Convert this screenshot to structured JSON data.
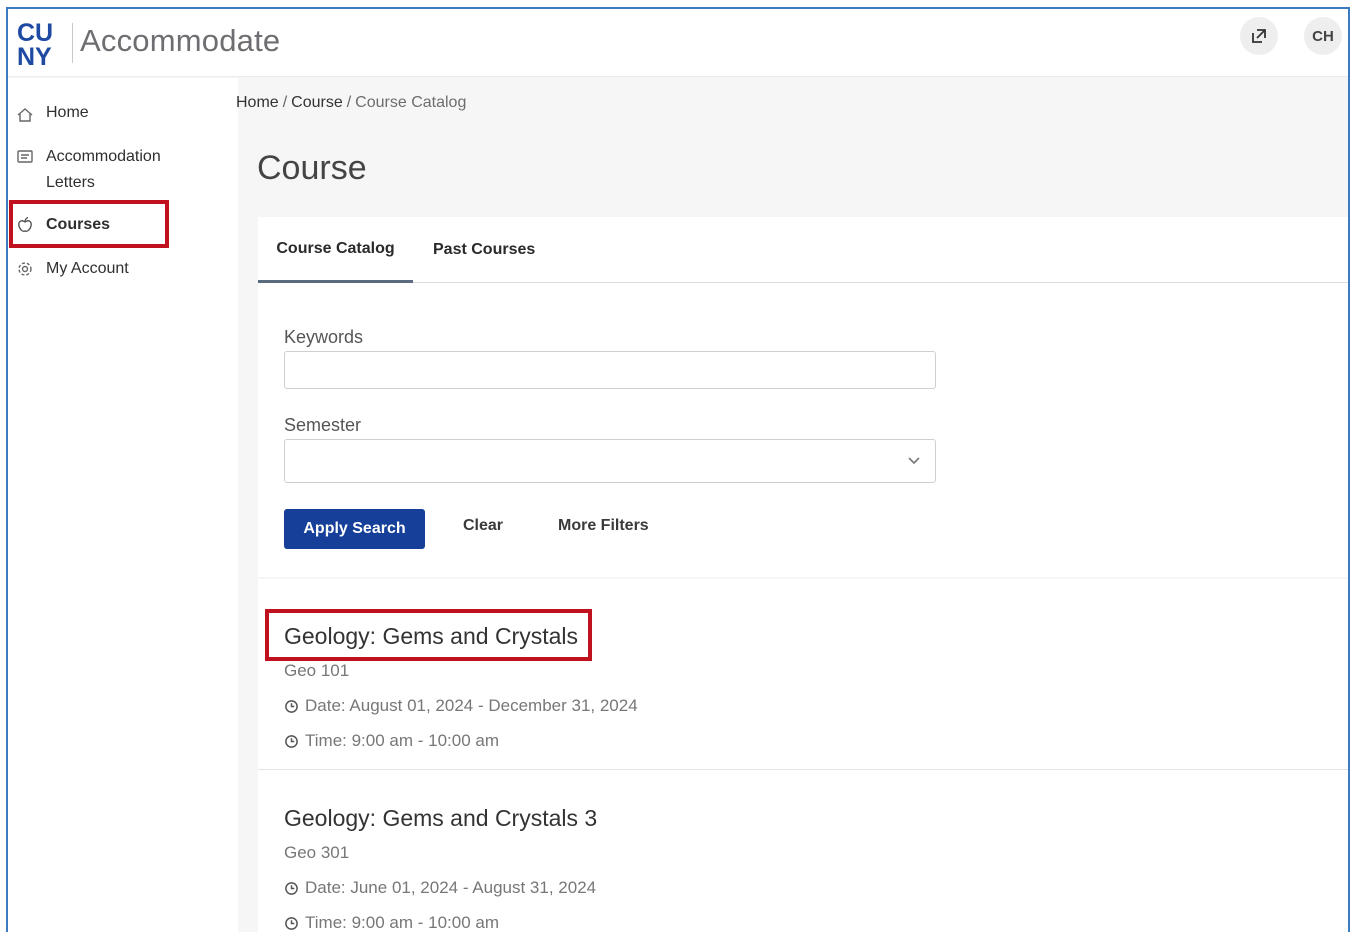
{
  "header": {
    "logo_text_top": "CU",
    "logo_text_bottom": "NY",
    "app_title": "Accommodate",
    "avatar_initials": "CH",
    "external_icon": "external-link-icon"
  },
  "sidebar": {
    "items": [
      {
        "label": "Home",
        "icon": "home-icon"
      },
      {
        "label": "Accommodation",
        "label2": "Letters",
        "icon": "letter-icon"
      },
      {
        "label": "Courses",
        "icon": "apple-icon"
      },
      {
        "label": "My Account",
        "icon": "gear-icon"
      }
    ]
  },
  "breadcrumb": {
    "home": "Home",
    "course": "Course",
    "current": "Course Catalog"
  },
  "page_title": "Course",
  "tabs": [
    {
      "label": "Course Catalog"
    },
    {
      "label": "Past Courses"
    }
  ],
  "search": {
    "keywords_label": "Keywords",
    "keywords_value": "",
    "semester_label": "Semester",
    "semester_value": "",
    "apply_label": "Apply Search",
    "clear_label": "Clear",
    "more_filters_label": "More Filters"
  },
  "colors": {
    "primary": "#153f99",
    "highlight": "#c0111f",
    "frame": "#3b7bbf",
    "logo": "#1e4aa3"
  },
  "courses": [
    {
      "title": "Geology: Gems and Crystals",
      "code": "Geo 101",
      "date": "Date: August 01, 2024 - December 31, 2024",
      "time": "Time: 9:00 am - 10:00 am"
    },
    {
      "title": "Geology: Gems and Crystals 3",
      "code": "Geo 301",
      "date": "Date: June 01, 2024 - August 31, 2024",
      "time": "Time: 9:00 am - 10:00 am"
    }
  ]
}
